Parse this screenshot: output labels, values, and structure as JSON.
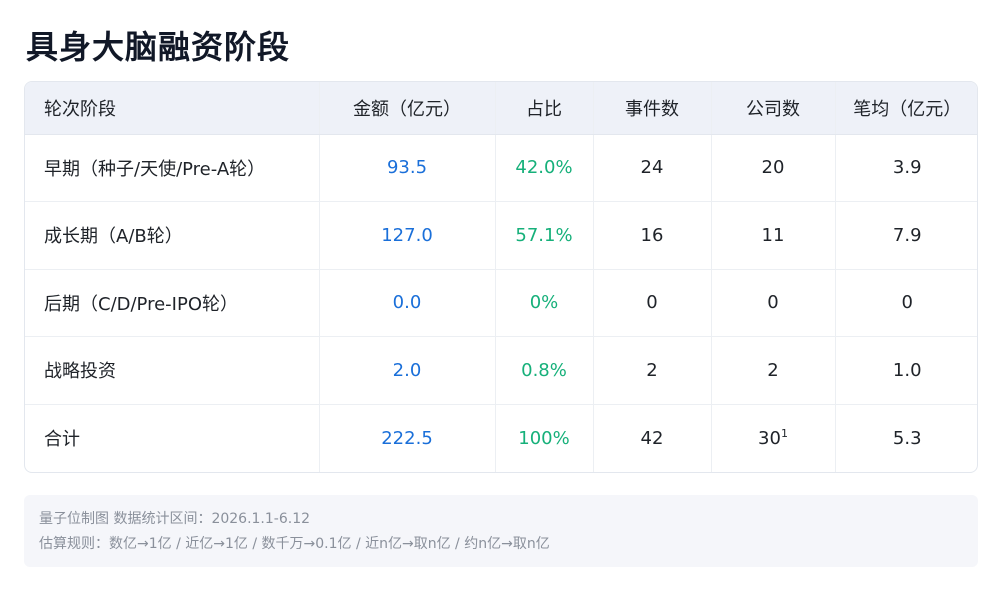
{
  "title": "具身大脑融资阶段",
  "table": {
    "headers": [
      "轮次阶段",
      "金额（亿元）",
      "占比",
      "事件数",
      "公司数",
      "笔均（亿元）"
    ],
    "rows": [
      {
        "stage": "早期（种子/天使/Pre-A轮）",
        "amount": "93.5",
        "share": "42.0%",
        "events": "24",
        "companies": "20",
        "companies_note": "",
        "avg": "3.9"
      },
      {
        "stage": "成长期（A/B轮）",
        "amount": "127.0",
        "share": "57.1%",
        "events": "16",
        "companies": "11",
        "companies_note": "",
        "avg": "7.9"
      },
      {
        "stage": "后期（C/D/Pre-IPO轮）",
        "amount": "0.0",
        "share": "0%",
        "events": "0",
        "companies": "0",
        "companies_note": "",
        "avg": "0"
      },
      {
        "stage": "战略投资",
        "amount": "2.0",
        "share": "0.8%",
        "events": "2",
        "companies": "2",
        "companies_note": "",
        "avg": "1.0"
      },
      {
        "stage": "合计",
        "amount": "222.5",
        "share": "100%",
        "events": "42",
        "companies": "30",
        "companies_note": "1",
        "avg": "5.3"
      }
    ]
  },
  "footer": {
    "source": "量子位制图  数据统计区间：2026.1.1-6.12",
    "rules": "估算规则：数亿→1亿 / 近亿→1亿 / 数千万→0.1亿 / 近n亿→取n亿 / 约n亿→取n亿"
  },
  "colors": {
    "amount": "#1a6fd9",
    "share": "#16b07a",
    "header_bg": "#eef1f8"
  }
}
